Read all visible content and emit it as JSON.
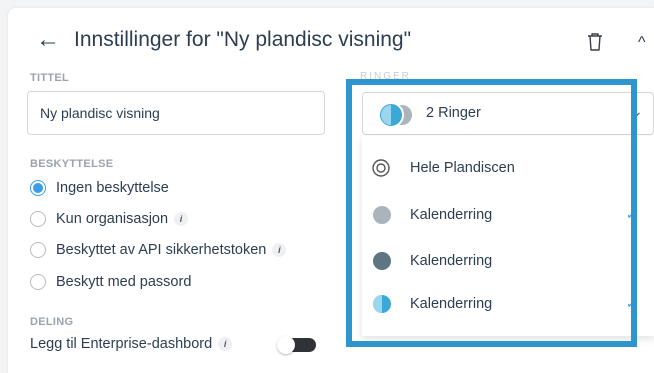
{
  "header": {
    "title": "Innstillinger for \"Ny plandisc visning\"",
    "back_glyph": "←",
    "collapse_glyph": "^"
  },
  "title_section": {
    "label": "TITTEL",
    "value": "Ny plandisc visning"
  },
  "protection": {
    "label": "BESKYTTELSE",
    "options": [
      {
        "label": "Ingen beskyttelse",
        "selected": true,
        "info": false
      },
      {
        "label": "Kun organisasjon",
        "selected": false,
        "info": true
      },
      {
        "label": "Beskyttet av API sikkerhetstoken",
        "selected": false,
        "info": true
      },
      {
        "label": "Beskytt med passord",
        "selected": false,
        "info": false
      }
    ]
  },
  "sharing": {
    "label": "DELING",
    "enterprise_label": "Legg til Enterprise-dashbord",
    "enterprise_on": true
  },
  "rings_select": {
    "hidden_label": "RINGER",
    "value": "2 Ringer",
    "chevron": "⌄",
    "options": [
      {
        "label": "Hele Plandiscen",
        "icon": "target-icon",
        "checked": false
      },
      {
        "label": "Kalenderring",
        "icon": "ring-icon",
        "color": "#a9b4bd",
        "checked": true
      },
      {
        "label": "Kalenderring",
        "icon": "ring-icon",
        "color": "#5d7682",
        "checked": false
      },
      {
        "label": "Kalenderring",
        "icon": "ring-icon",
        "color": "#3aa9d8",
        "checked": true
      }
    ],
    "check_glyph": "✓",
    "info_glyph": "i"
  },
  "colors": {
    "accent": "#3b9ce8",
    "highlight_border": "#2f95cf",
    "text": "#2c3e50",
    "muted_label": "#9aa3af"
  }
}
